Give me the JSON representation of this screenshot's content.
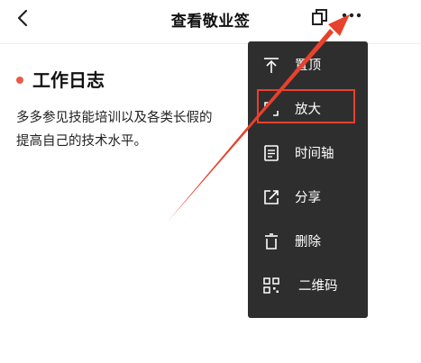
{
  "colors": {
    "accent_red": "#e8412c",
    "menu_bg": "#2e2e2e",
    "dot_red": "#e95a4a"
  },
  "navbar": {
    "back_icon": "chevron-left-icon",
    "title": "查看敬业签",
    "copy_icon": "copy-icon",
    "more_icon": "more-horizontal-icon"
  },
  "note": {
    "title": "工作日志",
    "body_lines": [
      "多多参见技能培训以及各类长假的",
      "提高自己的技术水平。"
    ]
  },
  "menu": {
    "items": [
      {
        "label": "置顶",
        "icon": "pin-top-icon"
      },
      {
        "label": "放大",
        "icon": "zoom-icon"
      },
      {
        "label": "时间轴",
        "icon": "timeline-icon"
      },
      {
        "label": "分享",
        "icon": "share-icon"
      },
      {
        "label": "删除",
        "icon": "trash-icon"
      },
      {
        "label": "二维码",
        "icon": "qrcode-icon"
      }
    ]
  }
}
